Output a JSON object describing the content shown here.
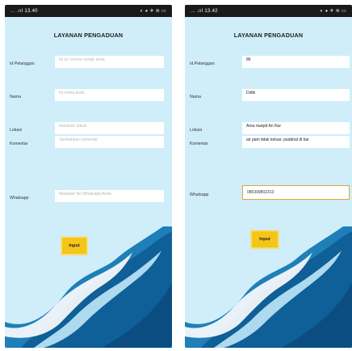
{
  "screens": [
    {
      "status_left": "... .ııl 13.40",
      "status_right": "◐ ◕ ✈ ≋ ▭",
      "title": "LAYANAN PENGADUAN",
      "fields": [
        {
          "label": "Id Pelanggan",
          "text": "Isi id / nomor rumah anda",
          "type": "placeholder"
        },
        {
          "label": "Nama",
          "text": "Isi nama anda",
          "type": "placeholder"
        },
        {
          "label": "Lokasi",
          "text": "masukan lokasi",
          "type": "placeholder"
        },
        {
          "label": "Komentar",
          "text": "Tambahkan komentar",
          "type": "placeholder"
        },
        {
          "label": "Whatsapp",
          "text": "Masukan No Whatsapp Anda",
          "type": "placeholder"
        }
      ],
      "button_label": "Input"
    },
    {
      "status_left": "... .ııl 13.42",
      "status_right": "◐ ◕ ✈ ≋ ▭",
      "title": "LAYANAN PENGADUAN",
      "fields": [
        {
          "label": "Id Pelanggan",
          "text": "86",
          "type": "value"
        },
        {
          "label": "Nama",
          "text": "Didik",
          "type": "value"
        },
        {
          "label": "Lokasi",
          "text": "Area masjid An Nur",
          "type": "value"
        },
        {
          "label": "Komentar",
          "text": "air pam tidak keluar, padahal di bai",
          "type": "value"
        },
        {
          "label": "Whatsapp",
          "text": "085399802313",
          "type": "value-active"
        }
      ],
      "button_label": "Input"
    }
  ]
}
